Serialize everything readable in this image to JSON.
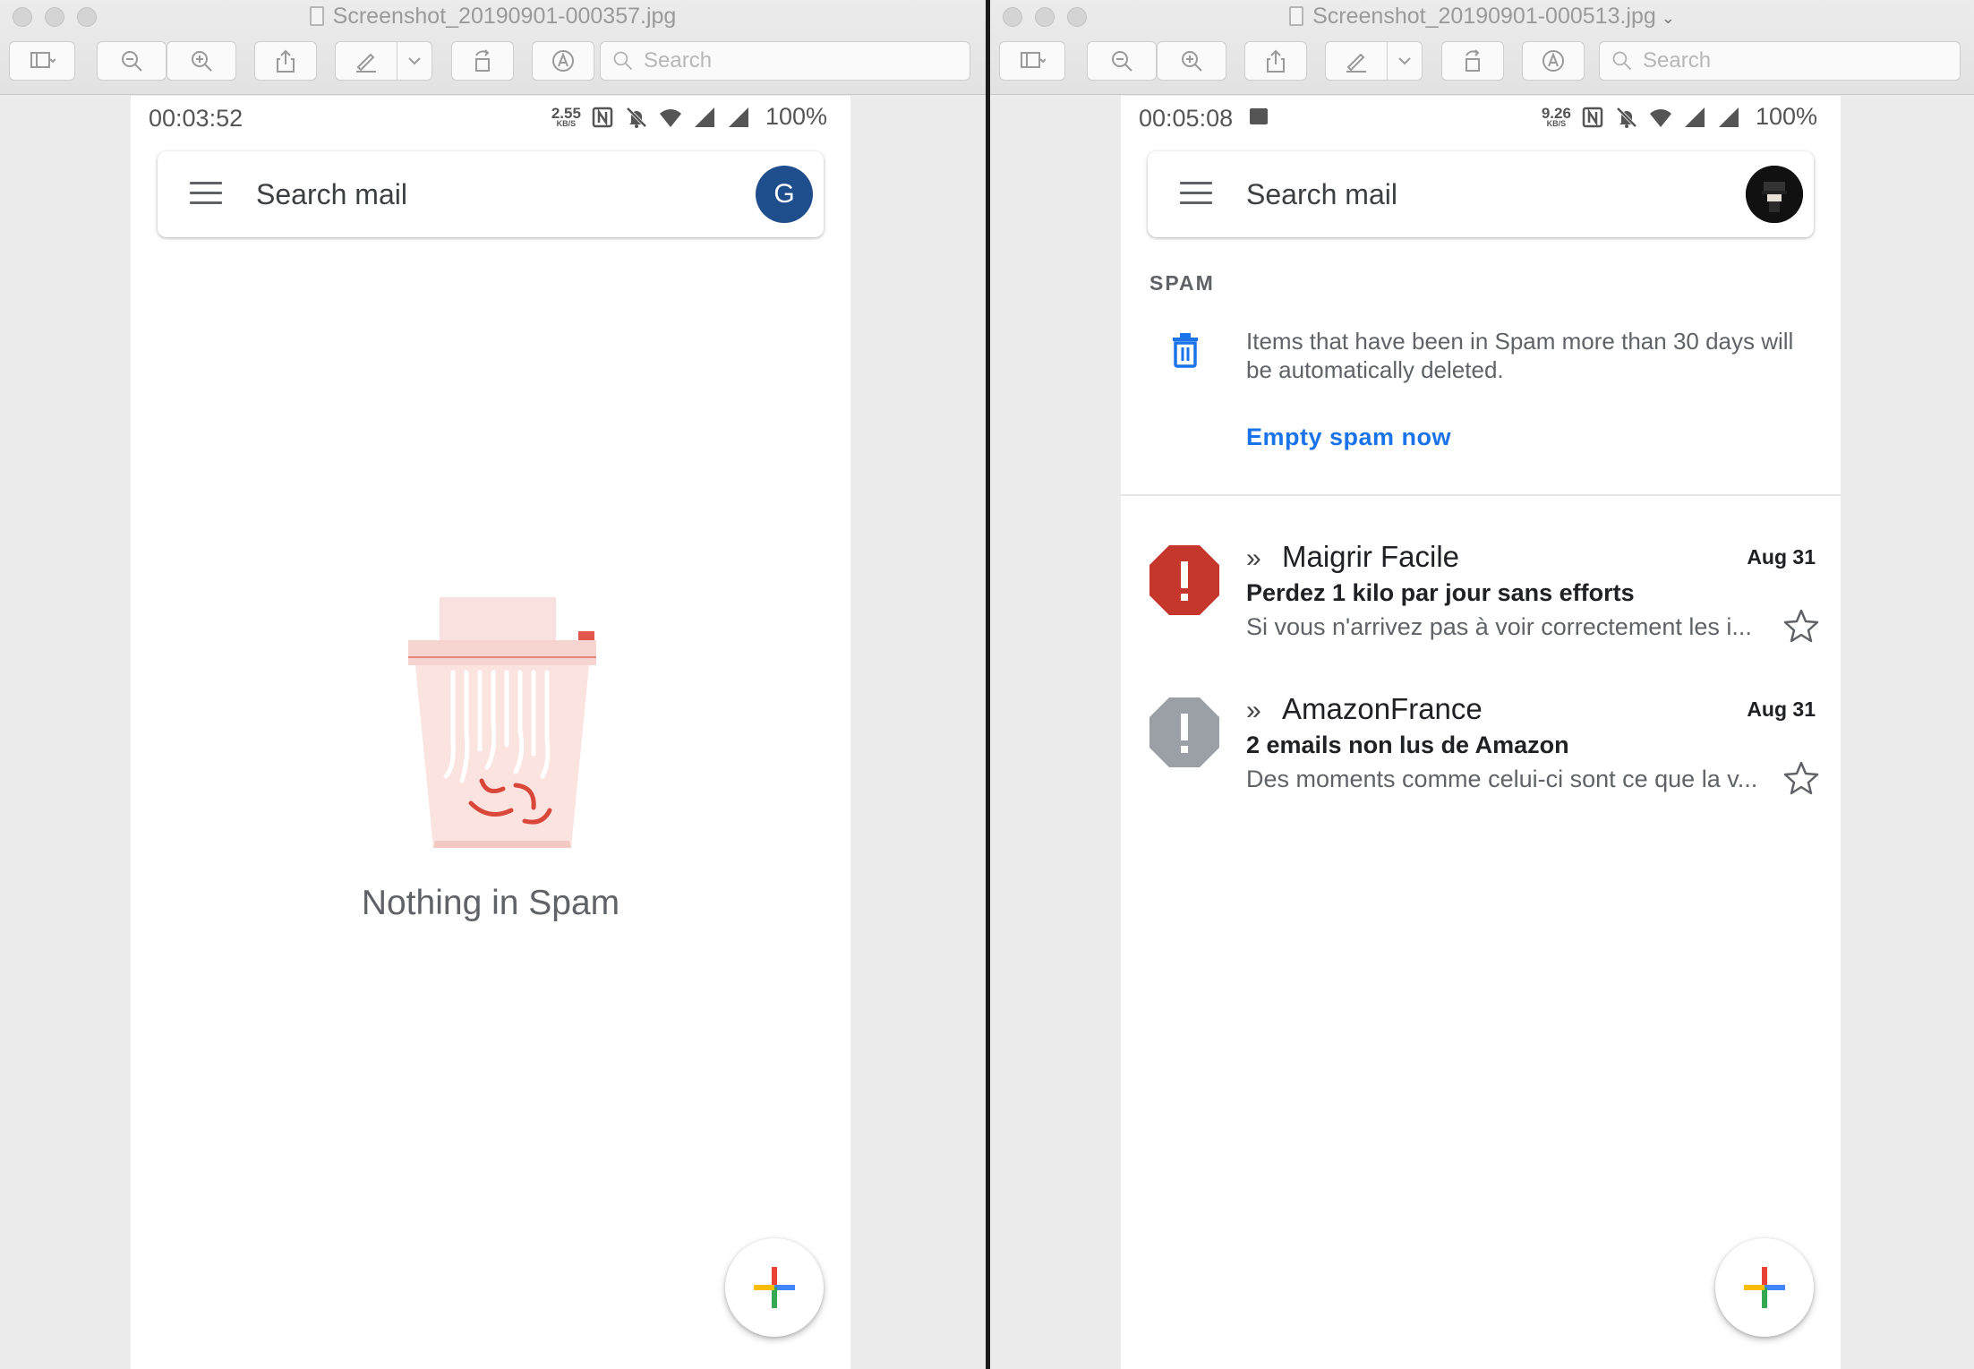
{
  "left_window": {
    "title": "Screenshot_20190901-000357.jpg",
    "search_placeholder": "Search",
    "phone": {
      "time": "00:03:52",
      "net_speed": "2.55",
      "net_unit": "KB/S",
      "battery": "100%",
      "search_label": "Search mail",
      "avatar_letter": "G",
      "empty_text": "Nothing in Spam"
    }
  },
  "right_window": {
    "title": "Screenshot_20190901-000513.jpg",
    "search_placeholder": "Search",
    "phone": {
      "time": "00:05:08",
      "net_speed": "9.26",
      "net_unit": "KB/S",
      "battery": "100%",
      "search_label": "Search mail",
      "section_title": "SPAM",
      "notice": "Items that have been in Spam more than 30 days will be automatically deleted.",
      "empty_link": "Empty spam now",
      "emails": [
        {
          "sender": "Maigrir Facile",
          "date": "Aug 31",
          "subject": "Perdez 1 kilo par jour sans efforts",
          "snippet": "Si vous n'arrivez pas à voir correctement les i...",
          "badge_color": "#c5372c"
        },
        {
          "sender": "AmazonFrance",
          "date": "Aug 31",
          "subject": "2 emails non lus de Amazon",
          "snippet": "Des moments comme celui-ci sont ce que la v...",
          "badge_color": "#9aa0a6"
        }
      ]
    }
  },
  "colors": {
    "link": "#1a73e8",
    "avatar": "#1f4e8c"
  }
}
